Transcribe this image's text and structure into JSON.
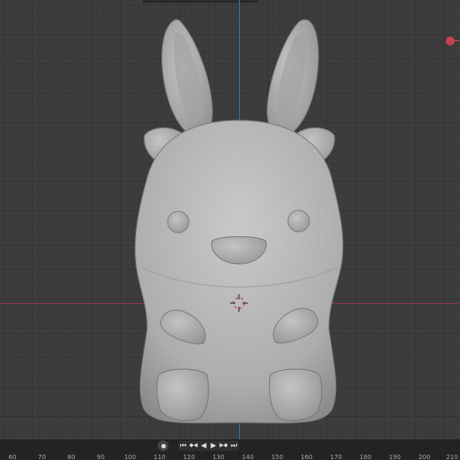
{
  "timeline": {
    "ruler_ticks": [
      "60",
      "70",
      "80",
      "90",
      "100",
      "110",
      "120",
      "130",
      "140",
      "150",
      "160",
      "170",
      "180",
      "190",
      "200",
      "210"
    ]
  },
  "controls": {
    "keyframe": "●",
    "jump_start": "⏮",
    "prev_key": "◆◀",
    "play_reverse": "◀",
    "play": "▶",
    "next_key": "▶◆",
    "jump_end": "⏭"
  },
  "colors": {
    "viewport_bg": "#3d3d3d",
    "x_axis": "#8a3c48",
    "y_axis": "#3e6eaa",
    "model": "#b4b4b4",
    "timeline_bg": "#232323"
  },
  "icons": [
    "keyframe-icon",
    "jump-start-icon",
    "prev-keyframe-icon",
    "play-reverse-icon",
    "play-icon",
    "next-keyframe-icon",
    "jump-end-icon",
    "3d-cursor-icon",
    "axis-gizmo-icon"
  ]
}
